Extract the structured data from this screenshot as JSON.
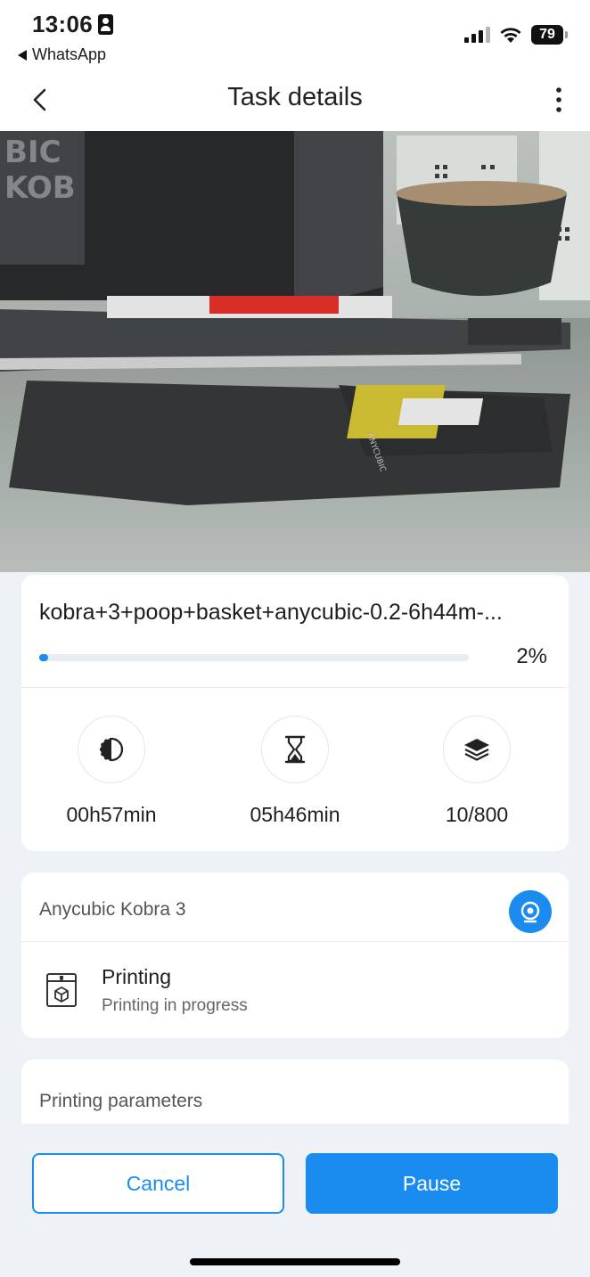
{
  "status_bar": {
    "time": "13:06",
    "back_app": "WhatsApp",
    "battery": "79",
    "icons": [
      "id-badge-icon",
      "signal-icon",
      "wifi-icon",
      "battery-icon"
    ]
  },
  "nav": {
    "title": "Task details",
    "icons": [
      "chevron-left-icon",
      "more-vertical-icon"
    ]
  },
  "camera": {
    "image_text": "ANYCUBIC"
  },
  "task": {
    "file_name": "kobra+3+poop+basket+anycubic-0.2-6h44m-...",
    "progress": 0.02,
    "progress_label": "2%",
    "stats": [
      {
        "icon": "half-circle-clock-icon",
        "value": "00h57min"
      },
      {
        "icon": "hourglass-icon",
        "value": "05h46min"
      },
      {
        "icon": "layers-icon",
        "value": "10/800"
      }
    ]
  },
  "device": {
    "name": "Anycubic Kobra 3",
    "camera_button_icon": "camera-icon",
    "status_icon": "printer-box-icon",
    "status_title": "Printing",
    "status_subtitle": "Printing in progress"
  },
  "params": {
    "title": "Printing parameters"
  },
  "actions": {
    "cancel_label": "Cancel",
    "pause_label": "Pause"
  },
  "colors": {
    "accent": "#1a8cf0",
    "background": "#eef1f5",
    "card": "#ffffff"
  }
}
